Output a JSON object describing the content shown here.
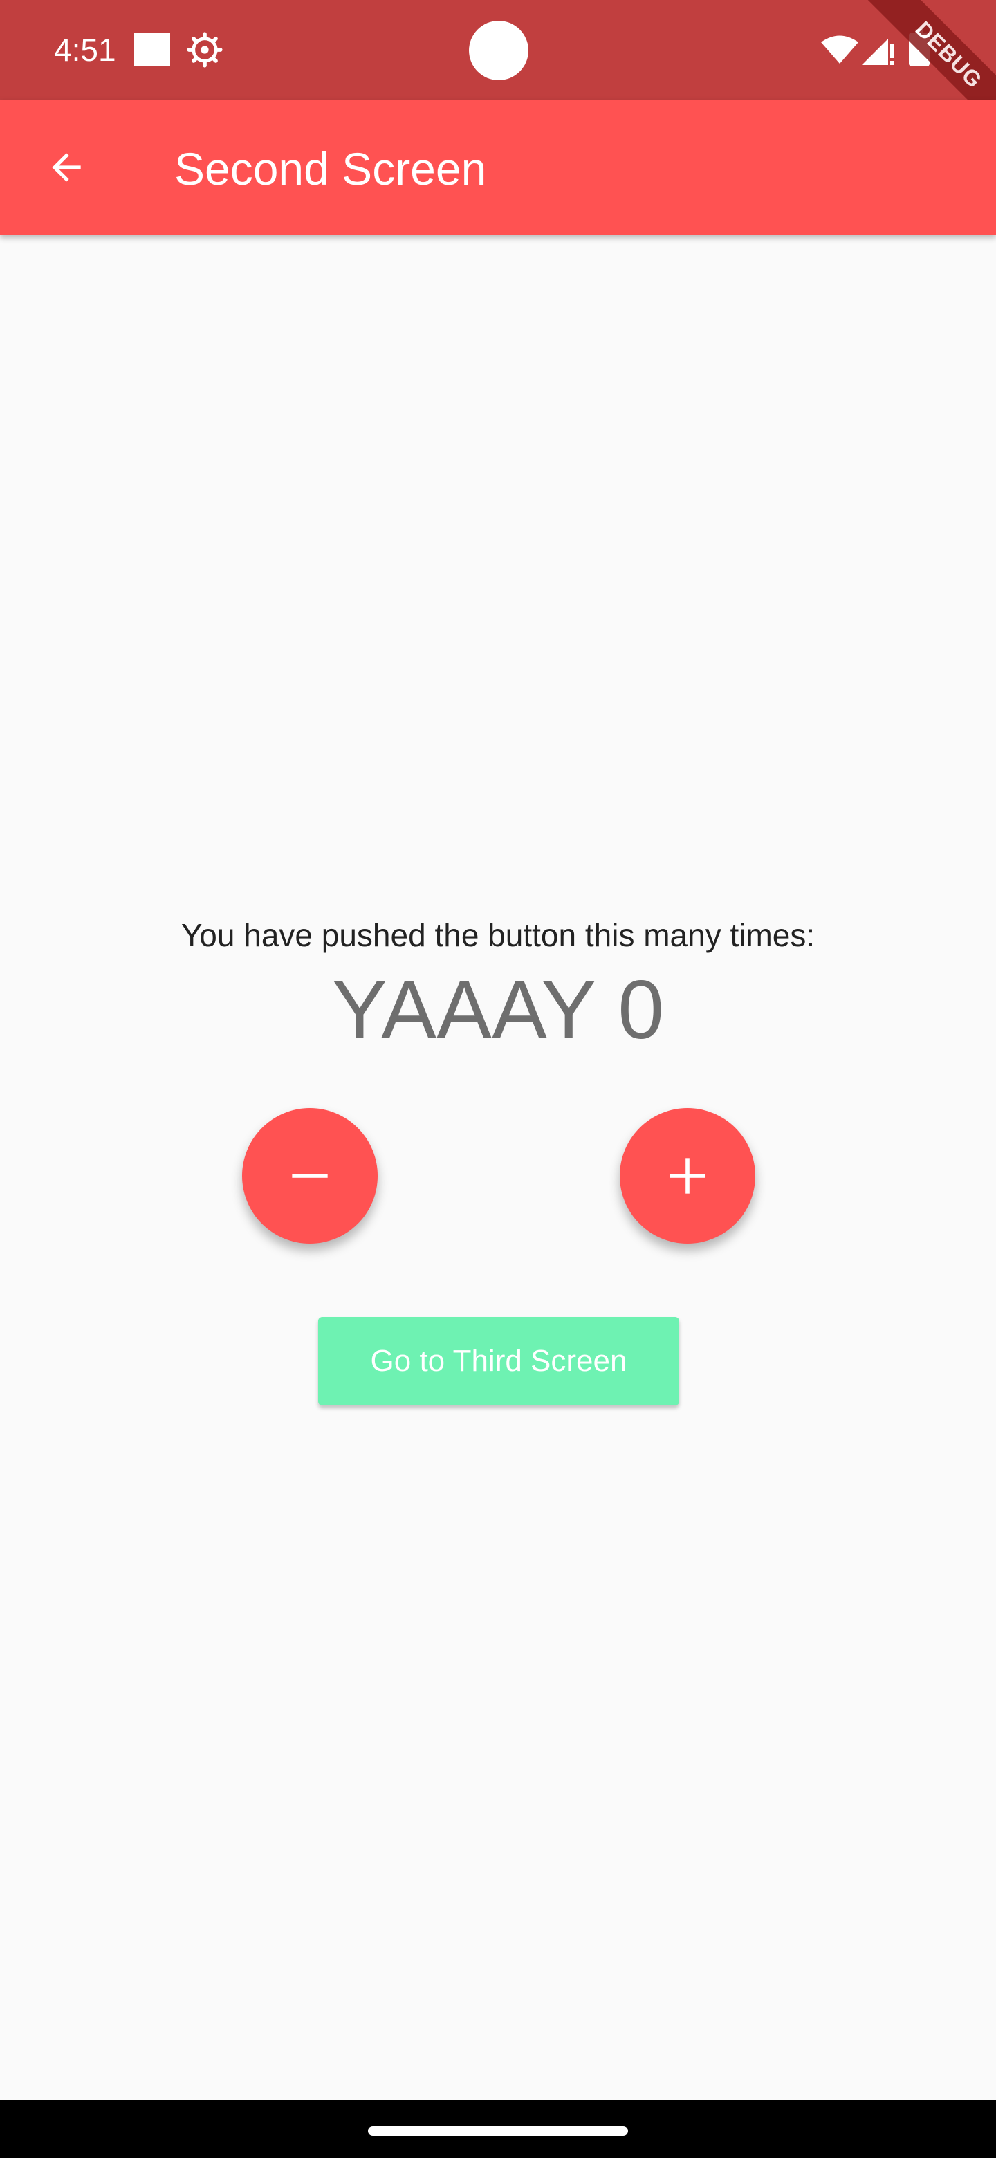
{
  "status_bar": {
    "time": "4:51",
    "icons": [
      "stop-square-icon",
      "settings-gear-icon",
      "wifi-icon",
      "cell-signal-icon",
      "battery-icon"
    ]
  },
  "debug_banner": {
    "label": "DEBUG"
  },
  "app_bar": {
    "title": "Second Screen",
    "back_icon": "arrow-back-icon"
  },
  "content": {
    "counter_label": "You have pushed the button this many times:",
    "counter_value": "YAAAY 0",
    "decrement_icon": "minus-icon",
    "increment_icon": "plus-icon",
    "third_screen_button": "Go to Third Screen"
  },
  "colors": {
    "status_bar": "#c13f3f",
    "app_bar": "#ff5252",
    "fab": "#ff5252",
    "button": "#6ef2b2",
    "background": "#fafafa"
  }
}
